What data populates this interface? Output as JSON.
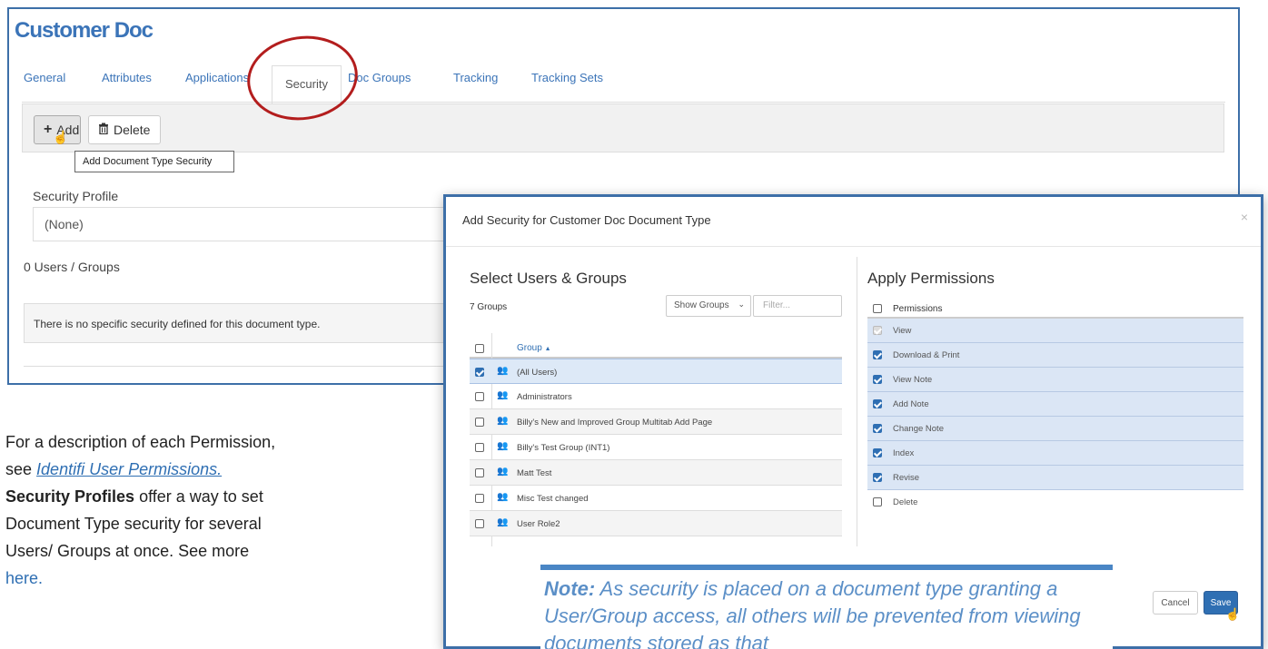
{
  "page": {
    "title": "Customer Doc"
  },
  "tabs": [
    {
      "label": "General"
    },
    {
      "label": "Attributes"
    },
    {
      "label": "Applications"
    },
    {
      "label": "Security"
    },
    {
      "label": "Doc Groups"
    },
    {
      "label": "Tracking"
    },
    {
      "label": "Tracking Sets"
    }
  ],
  "active_tab": "Security",
  "toolbar": {
    "add_label": "Add",
    "delete_label": "Delete",
    "add_tooltip": "Add Document Type Security"
  },
  "security_profile": {
    "label": "Security Profile",
    "value": "(None)"
  },
  "users_groups_count": "0 Users / Groups",
  "no_security_message": "There is no specific security defined for this document type.",
  "help_text": {
    "line1": "For a description of each Permission,",
    "see": "see",
    "link1": "Identifi User Permissions.",
    "bold": "Security Profiles",
    "line3": "offer a way to set",
    "line4": "Document Type security for several",
    "line5": "Users/ Groups at once.  See more",
    "link2": "here."
  },
  "modal": {
    "title": "Add Security for Customer Doc Document Type",
    "close": "×",
    "select_heading": "Select Users & Groups",
    "groups_count": "7 Groups",
    "show_select": "Show Groups",
    "filter_placeholder": "Filter...",
    "group_column": "Group",
    "groups": [
      {
        "name": "(All Users)",
        "checked": true
      },
      {
        "name": "Administrators",
        "checked": false
      },
      {
        "name": "Billy's New and Improved Group Multitab Add Page",
        "checked": false
      },
      {
        "name": "Billy's Test Group (INT1)",
        "checked": false
      },
      {
        "name": "Matt Test",
        "checked": false
      },
      {
        "name": "Misc Test changed",
        "checked": false
      },
      {
        "name": "User Role2",
        "checked": false
      }
    ],
    "permissions_heading": "Apply Permissions",
    "permissions_column": "Permissions",
    "permissions": [
      {
        "name": "View",
        "checked": true,
        "disabled": true
      },
      {
        "name": "Download & Print",
        "checked": true
      },
      {
        "name": "View Note",
        "checked": true
      },
      {
        "name": "Add Note",
        "checked": true
      },
      {
        "name": "Change Note",
        "checked": true
      },
      {
        "name": "Index",
        "checked": true
      },
      {
        "name": "Revise",
        "checked": true
      },
      {
        "name": "Delete",
        "checked": false
      }
    ],
    "cancel_label": "Cancel",
    "save_label": "Save"
  },
  "note": {
    "lead": "Note:",
    "text": "As security is placed on a document type granting a User/Group access, all others will be prevented from viewing documents stored as that"
  },
  "colors": {
    "accent": "#3b74b8",
    "border_blue": "#3d6fa8",
    "highlight_red": "#b31d1d",
    "selected_row": "#dde9f7"
  }
}
